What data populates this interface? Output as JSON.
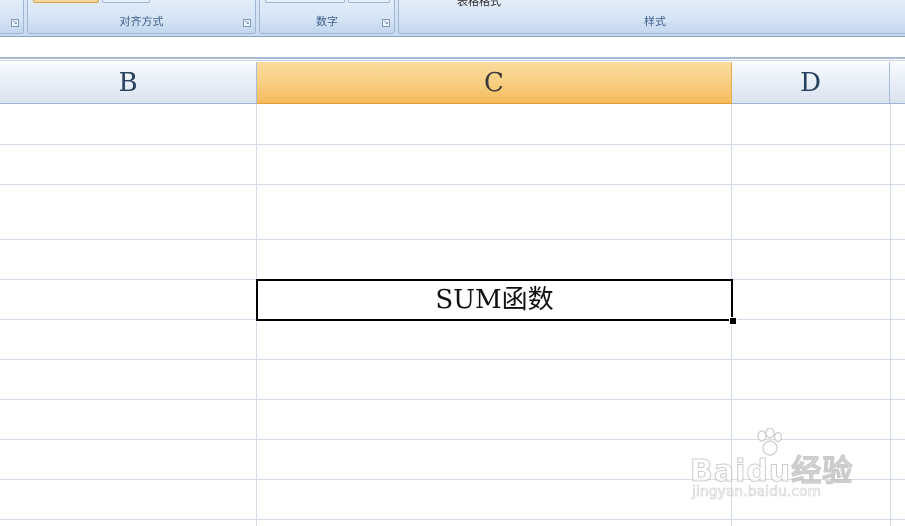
{
  "ribbon": {
    "groups": [
      {
        "label": "对齐方式"
      },
      {
        "label": "数字"
      },
      {
        "label": "样式"
      }
    ],
    "table_style_text": "表格格式"
  },
  "columns": [
    {
      "letter": "B",
      "selected": false
    },
    {
      "letter": "C",
      "selected": true
    },
    {
      "letter": "D",
      "selected": false
    }
  ],
  "active_cell": {
    "column": "C",
    "value": "SUM函数"
  },
  "watermark": {
    "brand": "Baidu经验",
    "url": "jingyan.baidu.com"
  },
  "colors": {
    "selected_header": "#f8cf82",
    "header": "#e8eef7",
    "gridline": "#d5dde8",
    "ribbon": "#d6e4f5"
  }
}
